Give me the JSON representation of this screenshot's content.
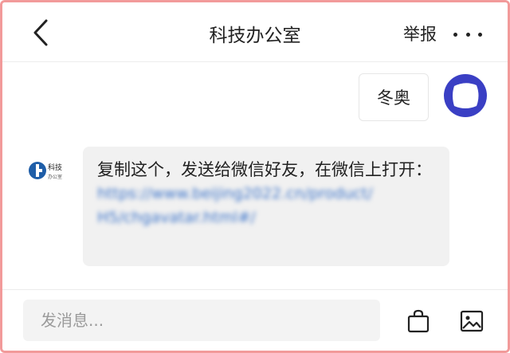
{
  "header": {
    "back_icon": "chevron-left-icon",
    "title": "科技办公室",
    "report_label": "举报",
    "more_icon": "more-horizontal-icon"
  },
  "chat": {
    "outgoing": {
      "text": "冬奥",
      "avatar_icon": "user-avatar",
      "avatar_ring_color": "#3a3fc4"
    },
    "incoming": {
      "avatar_label_line1": "科技",
      "avatar_label_line2": "办公室",
      "text": "复制这个，发送给微信好友，在微信上打开：",
      "link_line1": "https://www.beijing2022.cn/product/",
      "link_line2": "H5/chgavatar.html#/",
      "bubble_color": "#f1f1f1",
      "link_color": "#3b73c9"
    }
  },
  "footer": {
    "input_placeholder": "发消息...",
    "bag_icon": "shopping-bag-icon",
    "image_icon": "image-icon"
  },
  "colors": {
    "frame_border": "#f29a9a",
    "brand_blue": "#1f5ea8"
  }
}
